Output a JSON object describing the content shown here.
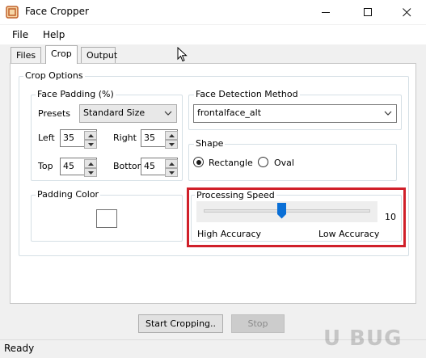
{
  "window": {
    "title": "Face Cropper",
    "minimize_icon": "minimize-icon",
    "maximize_icon": "maximize-icon",
    "close_icon": "close-icon"
  },
  "menu": {
    "items": [
      "File",
      "Help"
    ]
  },
  "tabs": {
    "items": [
      "Files",
      "Crop",
      "Output"
    ],
    "active": "Crop"
  },
  "crop_options": {
    "title": "Crop Options",
    "face_padding": {
      "title": "Face Padding (%)",
      "presets_label": "Presets",
      "presets_value": "Standard Size",
      "left_label": "Left",
      "left_value": "35",
      "right_label": "Right",
      "right_value": "35",
      "top_label": "Top",
      "top_value": "45",
      "bottom_label": "Bottom",
      "bottom_value": "45"
    },
    "face_detection": {
      "title": "Face Detection Method",
      "value": "frontalface_alt"
    },
    "shape": {
      "title": "Shape",
      "options": [
        "Rectangle",
        "Oval"
      ],
      "selected": "Rectangle"
    },
    "padding_color": {
      "title": "Padding Color",
      "swatch_color": "#ffffff"
    },
    "processing_speed": {
      "title": "Processing Speed",
      "value": 10,
      "value_label": "10",
      "slider_fraction": 0.47,
      "min_label": "High Accuracy",
      "max_label": "Low Accuracy",
      "highlight_color": "#d0202a",
      "thumb_color": "#0a6fd6"
    }
  },
  "actions": {
    "start_label": "Start Cropping..",
    "stop_label": "Stop"
  },
  "status": {
    "text": "Ready"
  },
  "watermark": {
    "text": "U BUG"
  }
}
